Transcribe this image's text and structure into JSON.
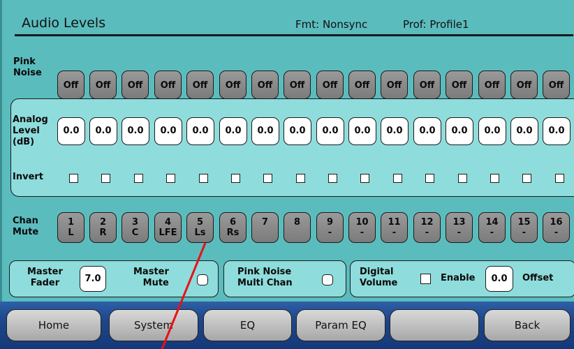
{
  "header": {
    "title": "Audio Levels",
    "format": "Fmt: Nonsync",
    "profile": "Prof: Profile1"
  },
  "pink_noise": {
    "label_line1": "Pink",
    "label_line2": "Noise",
    "buttons": [
      "Off",
      "Off",
      "Off",
      "Off",
      "Off",
      "Off",
      "Off",
      "Off",
      "Off",
      "Off",
      "Off",
      "Off",
      "Off",
      "Off",
      "Off",
      "Off"
    ]
  },
  "analog_level": {
    "label_line1": "Analog",
    "label_line2": "Level",
    "label_line3": "(dB)",
    "values": [
      "0.0",
      "0.0",
      "0.0",
      "0.0",
      "0.0",
      "0.0",
      "0.0",
      "0.0",
      "0.0",
      "0.0",
      "0.0",
      "0.0",
      "0.0",
      "0.0",
      "0.0",
      "0.0"
    ]
  },
  "invert": {
    "label": "Invert",
    "checked": [
      false,
      false,
      false,
      false,
      false,
      false,
      false,
      false,
      false,
      false,
      false,
      false,
      false,
      false,
      false,
      false
    ]
  },
  "chan_mute": {
    "label_line1": "Chan",
    "label_line2": "Mute",
    "channels": [
      {
        "num": "1",
        "name": "L"
      },
      {
        "num": "2",
        "name": "R"
      },
      {
        "num": "3",
        "name": "C"
      },
      {
        "num": "4",
        "name": "LFE"
      },
      {
        "num": "5",
        "name": "Ls"
      },
      {
        "num": "6",
        "name": "Rs"
      },
      {
        "num": "7",
        "name": ""
      },
      {
        "num": "8",
        "name": ""
      },
      {
        "num": "9",
        "name": "-"
      },
      {
        "num": "10",
        "name": "-"
      },
      {
        "num": "11",
        "name": "-"
      },
      {
        "num": "12",
        "name": "-"
      },
      {
        "num": "13",
        "name": "-"
      },
      {
        "num": "14",
        "name": "-"
      },
      {
        "num": "15",
        "name": "-"
      },
      {
        "num": "16",
        "name": "-"
      }
    ]
  },
  "master": {
    "fader_line1": "Master",
    "fader_line2": "Fader",
    "fader_value": "7.0",
    "mute_line1": "Master",
    "mute_line2": "Mute"
  },
  "pink_multi": {
    "line1": "Pink Noise",
    "line2": "Multi Chan"
  },
  "digital_volume": {
    "line1": "Digital",
    "line2": "Volume",
    "enable_label": "Enable",
    "offset_value": "0.0",
    "offset_label": "Offset"
  },
  "nav": {
    "home": "Home",
    "system": "System",
    "eq": "EQ",
    "param_eq": "Param EQ",
    "blank": "",
    "back": "Back"
  },
  "colors": {
    "background": "#5bbcbe",
    "panel": "#8fdcdc",
    "button": "#8a8a8a",
    "navbar": "#1e4689",
    "annotation_line": "#e8101a"
  }
}
